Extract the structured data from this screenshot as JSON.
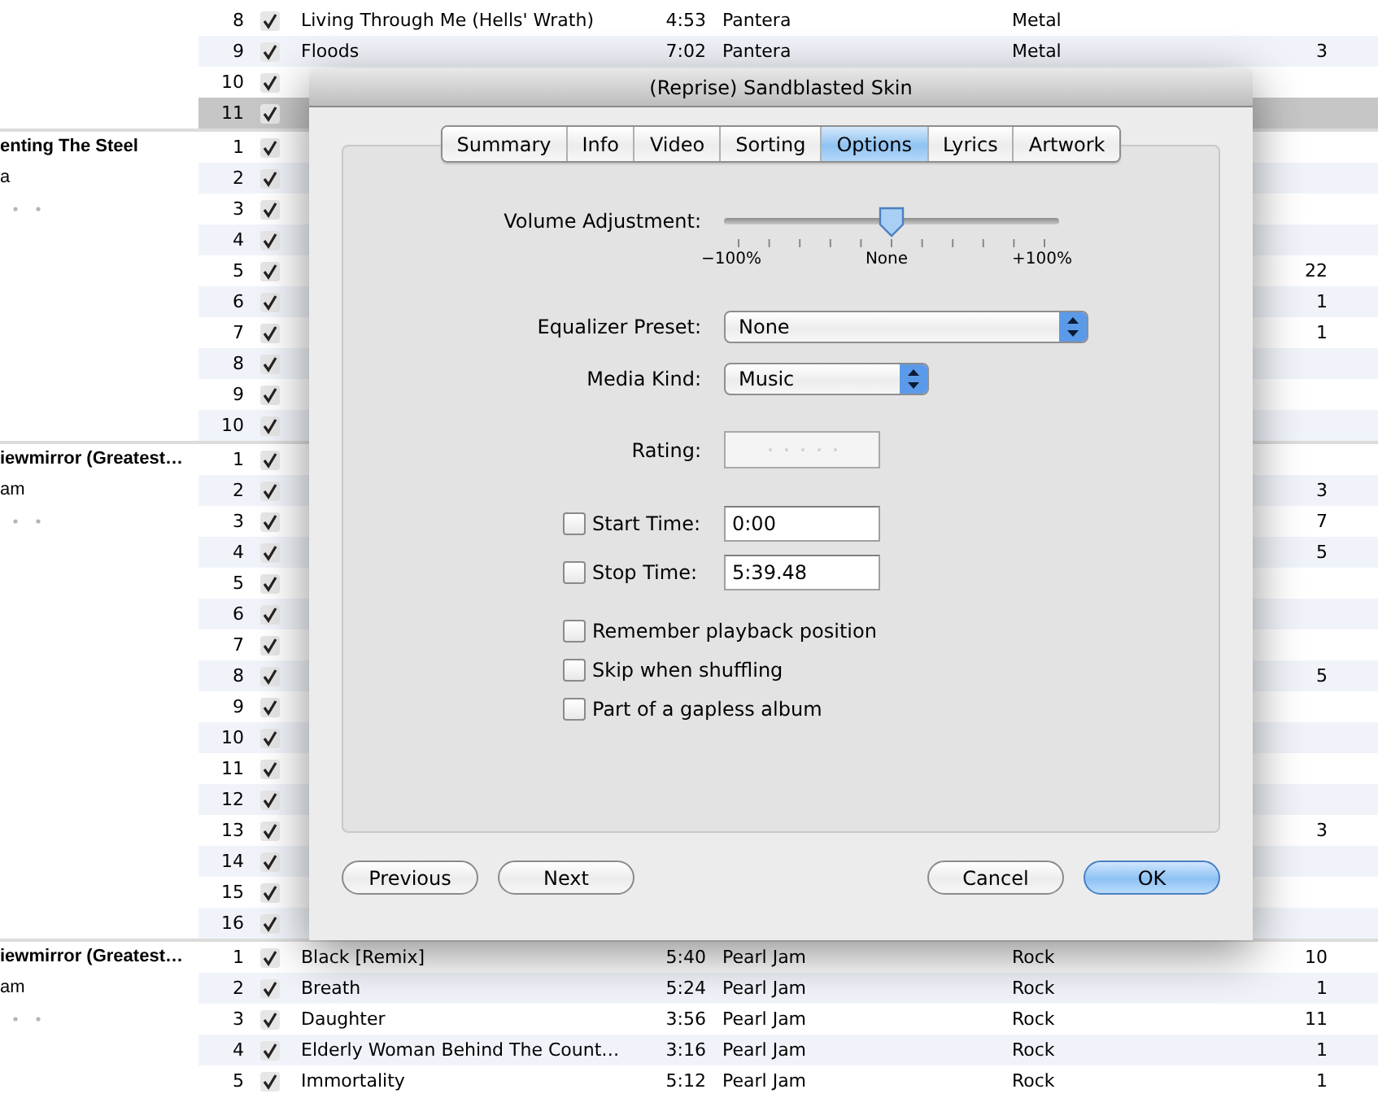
{
  "track_list": {
    "groups": [
      {
        "rows": [
          {
            "track": "8",
            "checked": true,
            "selected": false,
            "name": "Living Through Me (Hells' Wrath)",
            "time": "4:53",
            "artist": "Pantera",
            "genre": "Metal"
          },
          {
            "track": "9",
            "checked": true,
            "selected": false,
            "name": "Floods",
            "time": "7:02",
            "artist": "Pantera",
            "genre": "Metal",
            "plays": "3"
          },
          {
            "track": "10",
            "checked": true,
            "selected": false
          },
          {
            "track": "11",
            "checked": true,
            "selected": true
          }
        ]
      },
      {
        "album": "enting The Steel",
        "album_artist": "a",
        "rows": [
          {
            "track": "1",
            "checked": true,
            "selected": false
          },
          {
            "track": "2",
            "checked": true,
            "selected": false
          },
          {
            "track": "3",
            "checked": true,
            "selected": false
          },
          {
            "track": "4",
            "checked": true,
            "selected": false
          },
          {
            "track": "5",
            "checked": true,
            "selected": false,
            "plays": "22"
          },
          {
            "track": "6",
            "checked": true,
            "selected": false,
            "plays": "1"
          },
          {
            "track": "7",
            "checked": true,
            "selected": false,
            "plays": "1"
          },
          {
            "track": "8",
            "checked": true,
            "selected": false
          },
          {
            "track": "9",
            "checked": true,
            "selected": false
          },
          {
            "track": "10",
            "checked": true,
            "selected": false
          }
        ]
      },
      {
        "album": "iewmirror (Greatest…",
        "album_artist": "am",
        "rows": [
          {
            "track": "1",
            "checked": true,
            "selected": false
          },
          {
            "track": "2",
            "checked": true,
            "selected": false,
            "plays": "3"
          },
          {
            "track": "3",
            "checked": true,
            "selected": false,
            "plays": "7"
          },
          {
            "track": "4",
            "checked": true,
            "selected": false,
            "plays": "5"
          },
          {
            "track": "5",
            "checked": true,
            "selected": false
          },
          {
            "track": "6",
            "checked": true,
            "selected": false
          },
          {
            "track": "7",
            "checked": true,
            "selected": false
          },
          {
            "track": "8",
            "checked": true,
            "selected": false,
            "plays": "5"
          },
          {
            "track": "9",
            "checked": true,
            "selected": false
          },
          {
            "track": "10",
            "checked": true,
            "selected": false
          },
          {
            "track": "11",
            "checked": true,
            "selected": false
          },
          {
            "track": "12",
            "checked": true,
            "selected": false
          },
          {
            "track": "13",
            "checked": true,
            "selected": false,
            "plays": "3"
          },
          {
            "track": "14",
            "checked": true,
            "selected": false
          },
          {
            "track": "15",
            "checked": true,
            "selected": false
          },
          {
            "track": "16",
            "checked": true,
            "selected": false
          }
        ]
      },
      {
        "album": "iewmirror (Greatest…",
        "album_artist": "am",
        "rows": [
          {
            "track": "1",
            "checked": true,
            "selected": false,
            "name": "Black [Remix]",
            "time": "5:40",
            "artist": "Pearl Jam",
            "genre": "Rock",
            "plays": "10"
          },
          {
            "track": "2",
            "checked": true,
            "selected": false,
            "name": "Breath",
            "time": "5:24",
            "artist": "Pearl Jam",
            "genre": "Rock",
            "plays": "1"
          },
          {
            "track": "3",
            "checked": true,
            "selected": false,
            "name": "Daughter",
            "time": "3:56",
            "artist": "Pearl Jam",
            "genre": "Rock",
            "plays": "11"
          },
          {
            "track": "4",
            "checked": true,
            "selected": false,
            "name": "Elderly Woman Behind The Count…",
            "time": "3:16",
            "artist": "Pearl Jam",
            "genre": "Rock",
            "plays": "1"
          },
          {
            "track": "5",
            "checked": true,
            "selected": false,
            "name": "Immortality",
            "time": "5:12",
            "artist": "Pearl Jam",
            "genre": "Rock",
            "plays": "1"
          }
        ]
      }
    ]
  },
  "dialog": {
    "title": "(Reprise) Sandblasted Skin",
    "tabs": [
      {
        "label": "Summary",
        "selected": false
      },
      {
        "label": "Info",
        "selected": false
      },
      {
        "label": "Video",
        "selected": false
      },
      {
        "label": "Sorting",
        "selected": false
      },
      {
        "label": "Options",
        "selected": true
      },
      {
        "label": "Lyrics",
        "selected": false
      },
      {
        "label": "Artwork",
        "selected": false
      }
    ],
    "volume": {
      "label": "Volume Adjustment:",
      "level": 0.5,
      "min_label": "−100%",
      "mid_label": "None",
      "max_label": "+100%"
    },
    "equalizer": {
      "label": "Equalizer Preset:",
      "value": "None"
    },
    "media_kind": {
      "label": "Media Kind:",
      "value": "Music"
    },
    "rating": {
      "label": "Rating:",
      "stars": 0
    },
    "start_time": {
      "label": "Start Time:",
      "checked": false,
      "value": "0:00"
    },
    "stop_time": {
      "label": "Stop Time:",
      "checked": false,
      "value": "5:39.48"
    },
    "options": [
      {
        "label": "Remember playback position",
        "checked": false
      },
      {
        "label": "Skip when shuffling",
        "checked": false
      },
      {
        "label": "Part of a gapless album",
        "checked": false
      }
    ],
    "buttons": [
      {
        "label": "Previous",
        "default": false
      },
      {
        "label": "Next",
        "default": false
      },
      {
        "label": "Cancel",
        "default": false
      },
      {
        "label": "OK",
        "default": true
      }
    ]
  }
}
